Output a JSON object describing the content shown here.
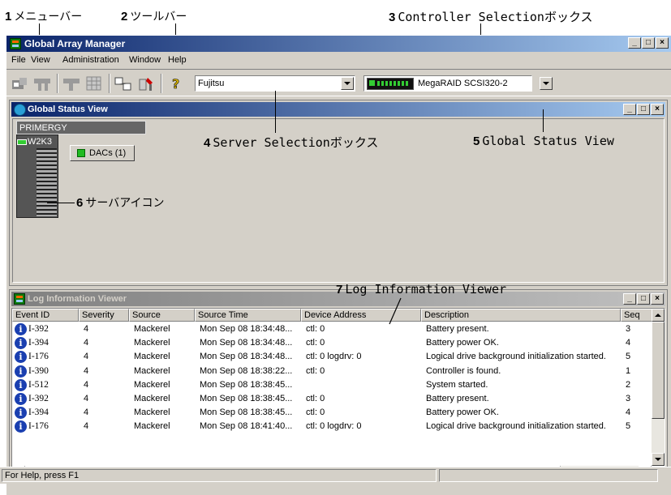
{
  "annotations": [
    {
      "num": "1",
      "label": "メニューバー"
    },
    {
      "num": "2",
      "label": "ツールバー"
    },
    {
      "num": "3",
      "label": "Controller Selectionボックス"
    },
    {
      "num": "4",
      "label": "Server Selectionボックス"
    },
    {
      "num": "5",
      "label": "Global Status View"
    },
    {
      "num": "6",
      "label": "サーバアイコン"
    },
    {
      "num": "7",
      "label": "Log Information Viewer"
    }
  ],
  "app": {
    "title": "Global Array Manager",
    "menu": [
      {
        "label": "File"
      },
      {
        "label": "View"
      },
      {
        "label": "Administration"
      },
      {
        "label": "Window"
      },
      {
        "label": "Help"
      }
    ],
    "server_select": {
      "value": "Fujitsu"
    },
    "controller_select": {
      "value": "MegaRAID SCSI320-2"
    }
  },
  "global_status": {
    "title": "Global Status View",
    "group_label": "PRIMERGY",
    "server_name": "W2K3",
    "dacs_label": "DACs (1)"
  },
  "log_viewer": {
    "title": "Log Information Viewer",
    "columns": [
      "Event ID",
      "Severity",
      "Source",
      "Source Time",
      "Device Address",
      "Description",
      "Seq"
    ],
    "rows": [
      [
        "I-392",
        "4",
        "Mackerel",
        "Mon Sep 08 18:34:48...",
        "ctl: 0",
        "Battery present.",
        "3"
      ],
      [
        "I-394",
        "4",
        "Mackerel",
        "Mon Sep 08 18:34:48...",
        "ctl: 0",
        "Battery power OK.",
        "4"
      ],
      [
        "I-176",
        "4",
        "Mackerel",
        "Mon Sep 08 18:34:48...",
        "ctl: 0 logdrv: 0",
        "Logical drive background initialization started.",
        "5"
      ],
      [
        "I-390",
        "4",
        "Mackerel",
        "Mon Sep 08 18:38:22...",
        "ctl: 0",
        "Controller is found.",
        "1"
      ],
      [
        "I-512",
        "4",
        "Mackerel",
        "Mon Sep 08 18:38:45...",
        "",
        "System started.",
        "2"
      ],
      [
        "I-392",
        "4",
        "Mackerel",
        "Mon Sep 08 18:38:45...",
        "ctl: 0",
        "Battery present.",
        "3"
      ],
      [
        "I-394",
        "4",
        "Mackerel",
        "Mon Sep 08 18:38:45...",
        "ctl: 0",
        "Battery power OK.",
        "4"
      ],
      [
        "I-176",
        "4",
        "Mackerel",
        "Mon Sep 08 18:41:40...",
        "ctl: 0 logdrv: 0",
        "Logical drive background initialization started.",
        "5"
      ]
    ]
  },
  "status_bar": {
    "text": "For Help, press F1"
  },
  "colors": {
    "title_active": "#0a246a",
    "title_inactive": "#808080",
    "info_icon": "#1a3fb0",
    "status_ok": "#22bb22"
  }
}
